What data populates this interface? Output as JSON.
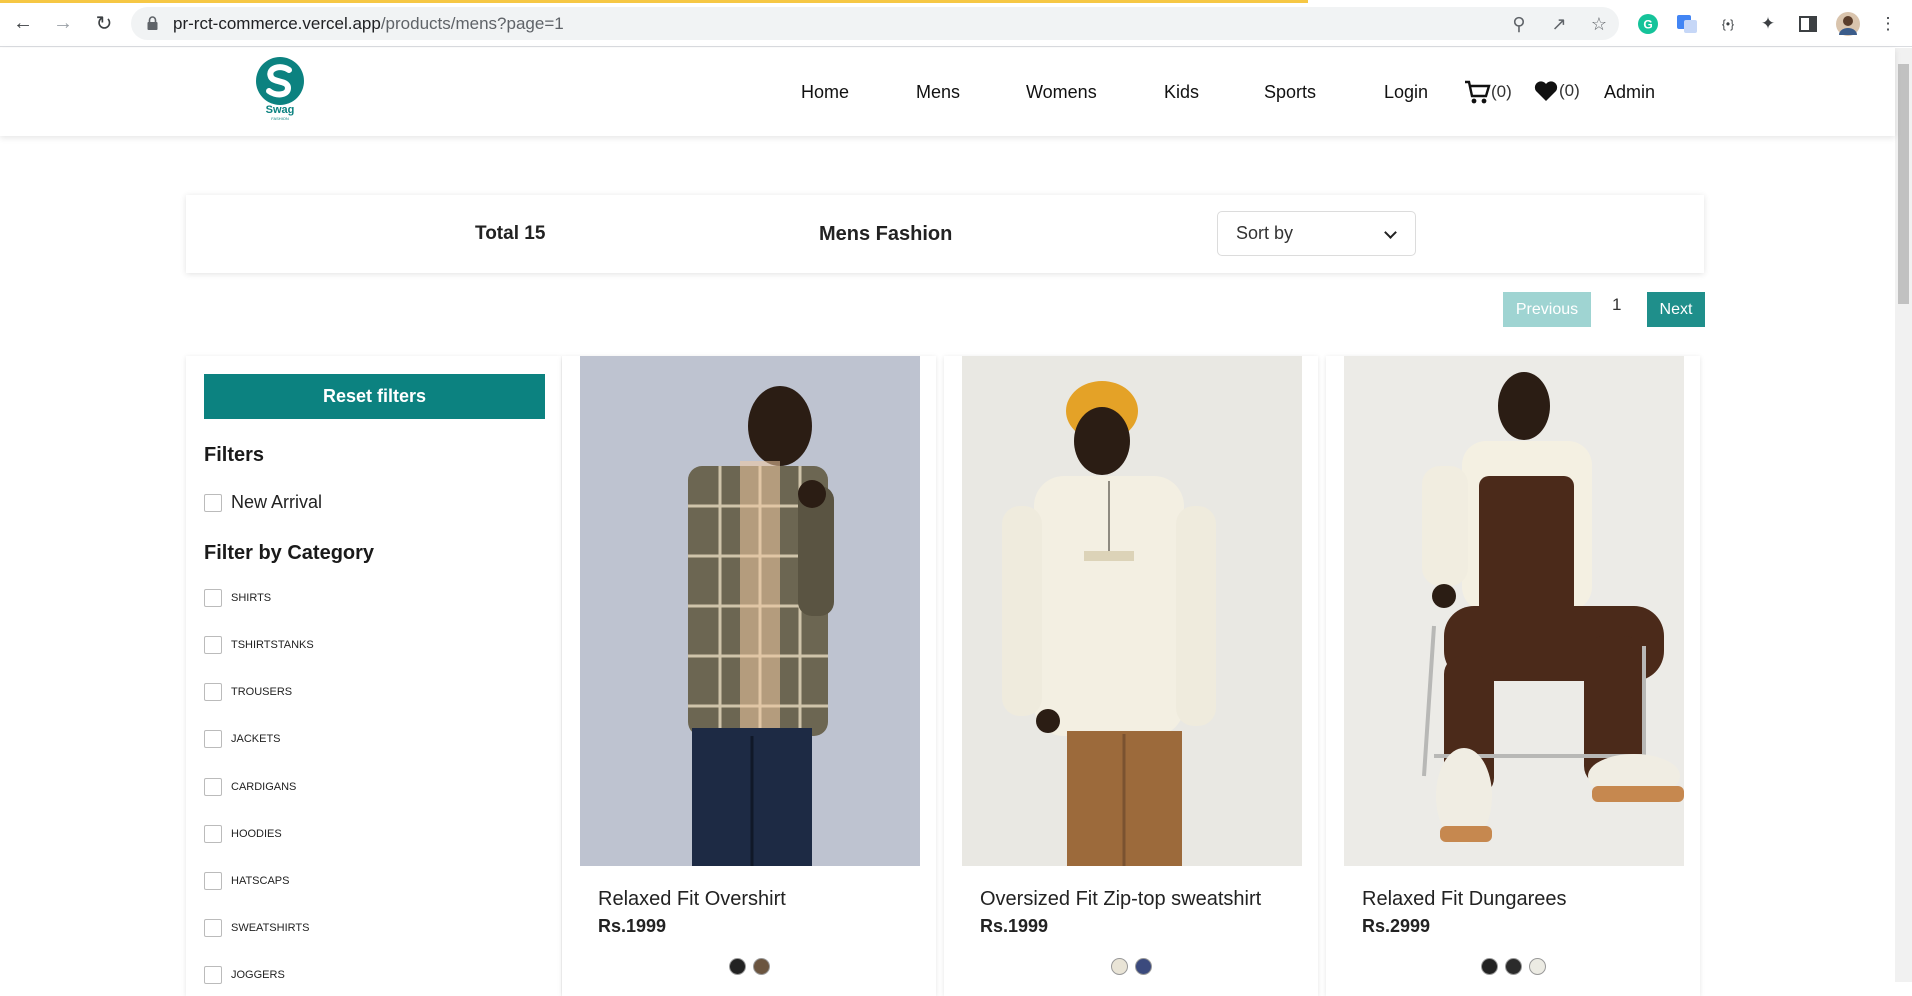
{
  "browser": {
    "url_host": "pr-rct-commerce.vercel.app",
    "url_path": "/products/mens?page=1"
  },
  "header": {
    "logo_text": "Swag",
    "logo_subtext": "FASHION",
    "nav": [
      "Home",
      "Mens",
      "Womens",
      "Kids",
      "Sports",
      "Login"
    ],
    "cart_count": "(0)",
    "wishlist_count": "(0)",
    "admin": "Admin",
    "brand_color": "#0c8280"
  },
  "toolbar": {
    "total": "Total 15",
    "title": "Mens Fashion",
    "sort_label": "Sort by"
  },
  "pagination": {
    "previous": "Previous",
    "current": "1",
    "next": "Next"
  },
  "filters": {
    "reset": "Reset filters",
    "heading": "Filters",
    "new_arrival": "New Arrival",
    "category_heading": "Filter by Category",
    "categories": [
      "SHIRTS",
      "TSHIRTSTANKS",
      "TROUSERS",
      "JACKETS",
      "CARDIGANS",
      "HOODIES",
      "HATSCAPS",
      "SWEATSHIRTS",
      "JOGGERS"
    ]
  },
  "products": [
    {
      "name": "Relaxed Fit Overshirt",
      "price": "Rs.1999",
      "swatches": [
        "#222222",
        "#6b5540"
      ]
    },
    {
      "name": "Oversized Fit Zip-top sweatshirt",
      "price": "Rs.1999",
      "swatches": [
        "#e9e4d6",
        "#3b4a7d"
      ]
    },
    {
      "name": "Relaxed Fit Dungarees",
      "price": "Rs.2999",
      "swatches": [
        "#222222",
        "#2b2b2b",
        "#ecebe3"
      ]
    }
  ]
}
